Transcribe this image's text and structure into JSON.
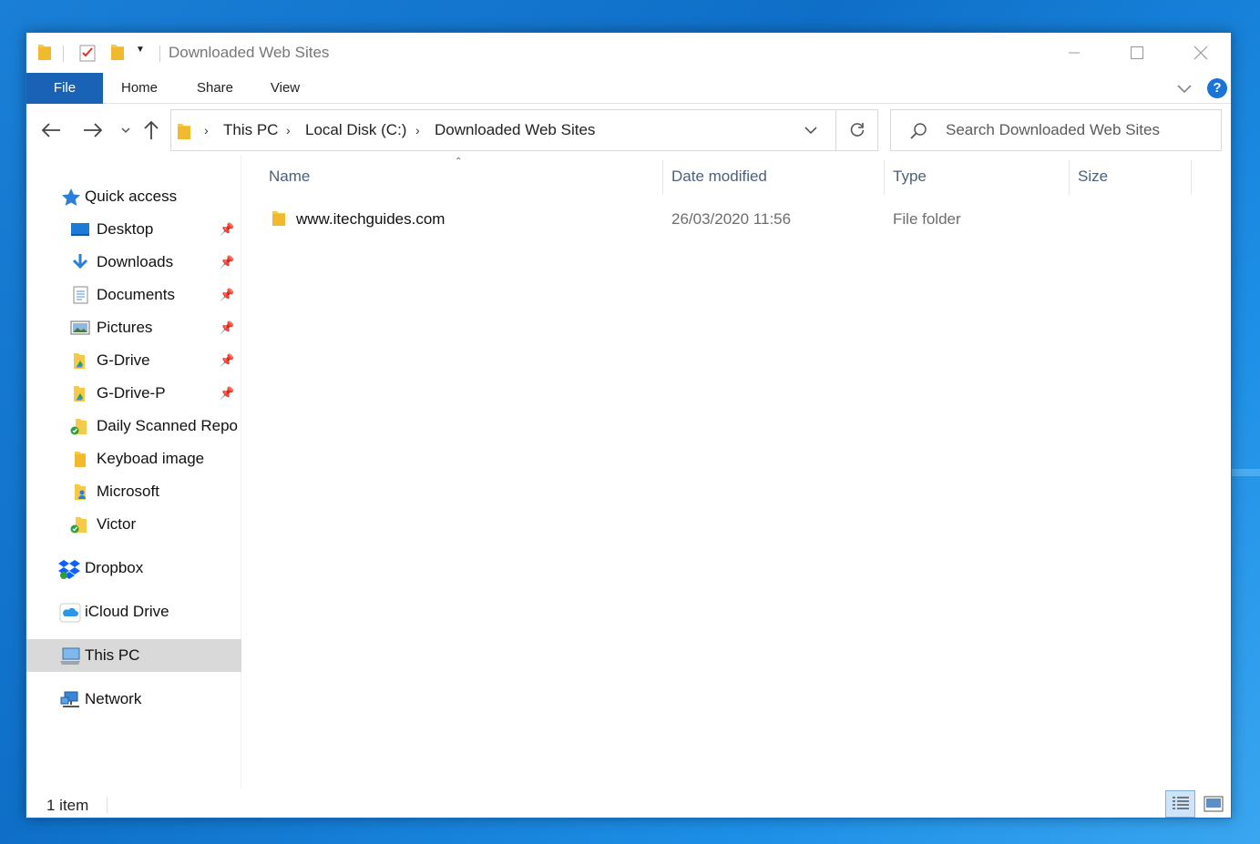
{
  "window": {
    "title": "Downloaded Web Sites"
  },
  "ribbon": {
    "tabs": [
      "File",
      "Home",
      "Share",
      "View"
    ],
    "help_label": "?"
  },
  "address": {
    "crumbs": [
      "This PC",
      "Local Disk (C:)",
      "Downloaded Web Sites"
    ]
  },
  "search": {
    "placeholder": "Search Downloaded Web Sites"
  },
  "navpane": {
    "quick_access": "Quick access",
    "pinned": [
      {
        "label": "Desktop",
        "icon": "desktop-icon"
      },
      {
        "label": "Downloads",
        "icon": "downloads-icon"
      },
      {
        "label": "Documents",
        "icon": "documents-icon"
      },
      {
        "label": "Pictures",
        "icon": "pictures-icon"
      },
      {
        "label": "G-Drive",
        "icon": "gdrive-folder-icon"
      },
      {
        "label": "G-Drive-P",
        "icon": "gdrive-folder-icon"
      }
    ],
    "recent": [
      {
        "label": "Daily Scanned Repo",
        "icon": "synced-folder-icon"
      },
      {
        "label": "Keyboad image",
        "icon": "folder-icon"
      },
      {
        "label": "Microsoft",
        "icon": "user-folder-icon"
      },
      {
        "label": "Victor",
        "icon": "synced-folder-icon"
      }
    ],
    "dropbox": "Dropbox",
    "icloud": "iCloud Drive",
    "this_pc": "This PC",
    "network": "Network"
  },
  "columns": {
    "name": "Name",
    "date": "Date modified",
    "type": "Type",
    "size": "Size"
  },
  "files": [
    {
      "name": "www.itechguides.com",
      "date": "26/03/2020 11:56",
      "type": "File folder",
      "size": ""
    }
  ],
  "status": {
    "count": "1 item"
  },
  "colors": {
    "accent": "#1a62b5",
    "folder": "#f7c948",
    "selection": "#d9d9d9"
  }
}
